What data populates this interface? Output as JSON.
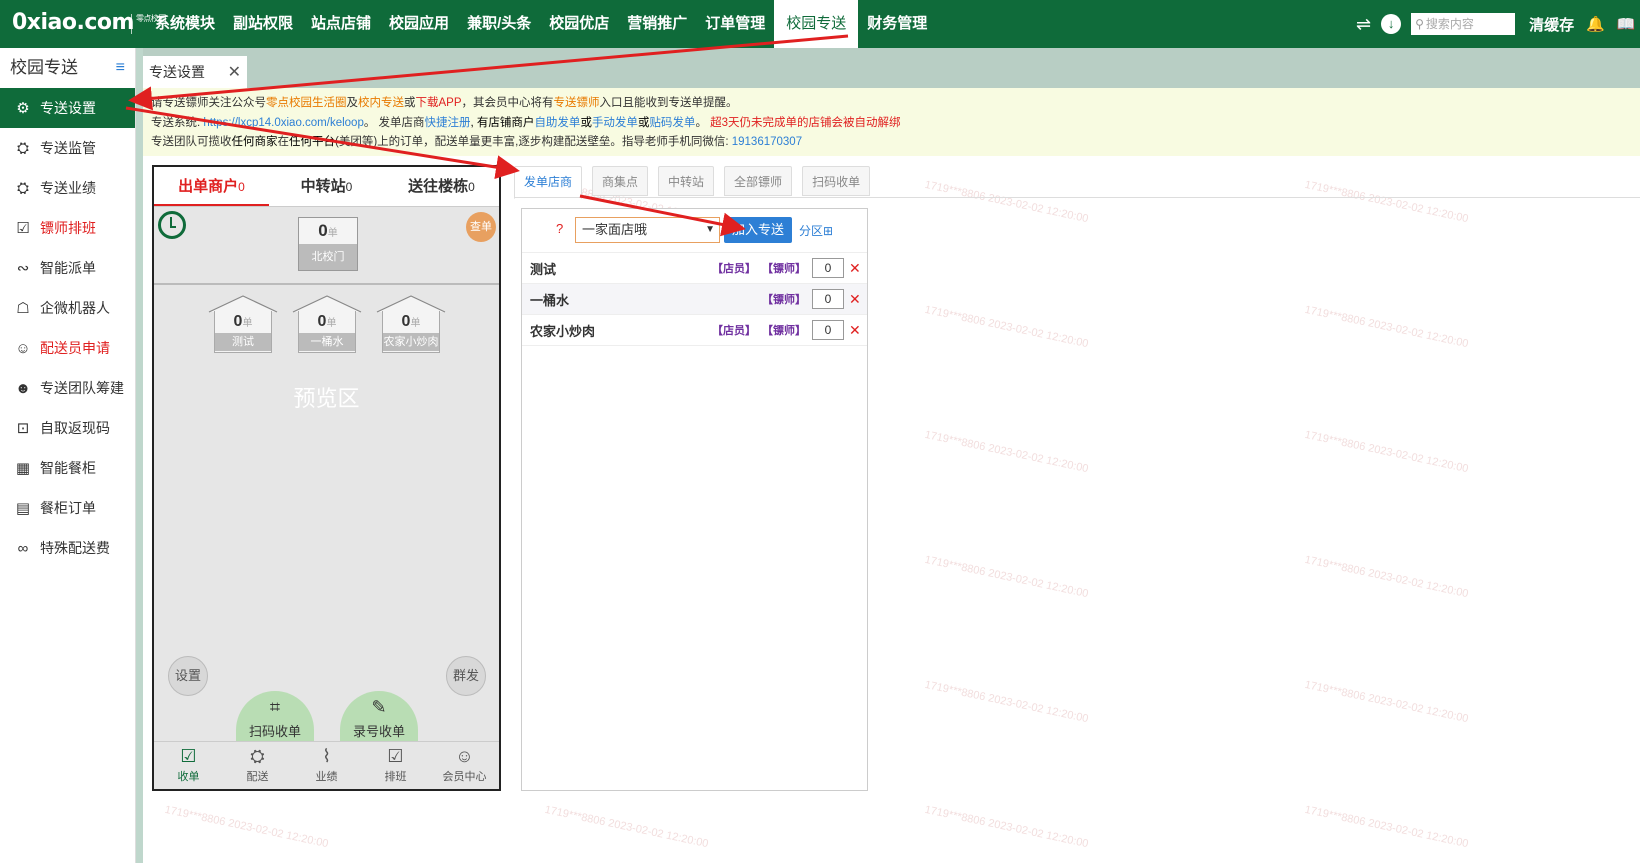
{
  "logo": {
    "text": "0xiao.com",
    "sub": "零点校园"
  },
  "nav": {
    "items": [
      "系统模块",
      "副站权限",
      "站点店铺",
      "校园应用",
      "兼职/头条",
      "校园优店",
      "营销推广",
      "订单管理",
      "校园专送",
      "财务管理"
    ],
    "active": "校园专送"
  },
  "top_right": {
    "switch_icon": "⇌",
    "download_icon": "↓",
    "search_placeholder": "搜索内容",
    "clear_cache": "清缓存",
    "bell_icon": "♫",
    "book_icon": "📖"
  },
  "sidebar": {
    "title": "校园专送",
    "toggle_icon": "≡",
    "items": [
      {
        "label": "专送设置",
        "icon": "⚙",
        "active": true,
        "red": false
      },
      {
        "label": "专送监管",
        "icon": "⛭",
        "active": false,
        "red": false
      },
      {
        "label": "专送业绩",
        "icon": "⛭",
        "active": false,
        "red": false
      },
      {
        "label": "镖师排班",
        "icon": "☑",
        "active": false,
        "red": true
      },
      {
        "label": "智能派单",
        "icon": "∾",
        "active": false,
        "red": false
      },
      {
        "label": "企微机器人",
        "icon": "☖",
        "active": false,
        "red": false
      },
      {
        "label": "配送员申请",
        "icon": "☺",
        "active": false,
        "red": true
      },
      {
        "label": "专送团队筹建",
        "icon": "☻",
        "active": false,
        "red": false
      },
      {
        "label": "自取返现码",
        "icon": "⊡",
        "active": false,
        "red": false
      },
      {
        "label": "智能餐柜",
        "icon": "▦",
        "active": false,
        "red": false
      },
      {
        "label": "餐柜订单",
        "icon": "▤",
        "active": false,
        "red": false
      },
      {
        "label": "特殊配送费",
        "icon": "∞",
        "active": false,
        "red": false
      }
    ]
  },
  "page_tab": {
    "label": "专送设置",
    "close": "✕"
  },
  "notice": {
    "l1_a": "请专送镖师关注公众号",
    "l1_b": "零点校园生活圈",
    "l1_c": "及",
    "l1_d": "校内专送",
    "l1_e": "或",
    "l1_f": "下载APP",
    "l1_g": "，其会员中心将有",
    "l1_h": "专送镖师",
    "l1_i": "入口且能收到专送单提醒。",
    "l2_a": "专送系统: ",
    "l2_b": "https://lxcp14.0xiao.com/keloop",
    "l2_c": "。 发单店商",
    "l2_d": "快捷注册",
    "l2_e": ", 有店铺商户",
    "l2_f": "自助发单",
    "l2_g": "或",
    "l2_h": "手动发单",
    "l2_i": "或",
    "l2_j": "贴码发单",
    "l2_k": "。 ",
    "l2_l": "超3天仍未完成单的店铺会被自动解绑",
    "l3_a": "专送团队可揽收",
    "l3_b": "任何商家",
    "l3_c": "在",
    "l3_d": "任何平台",
    "l3_e": "(美团等)上的订单，配送单量更丰富,逐步构建配送壁垒。指导老师手机同微信: ",
    "l3_f": "19136170307"
  },
  "phone": {
    "tabs": [
      {
        "label": "出单商户",
        "count": "0",
        "active": true
      },
      {
        "label": "中转站",
        "count": "0",
        "active": false
      },
      {
        "label": "送往楼栋",
        "count": "0",
        "active": false
      }
    ],
    "check_label": "查单",
    "gate": {
      "num": "0",
      "unit": "单",
      "label": "北校门"
    },
    "houses": [
      {
        "num": "0",
        "unit": "单",
        "label": "测试"
      },
      {
        "num": "0",
        "unit": "单",
        "label": "一桶水"
      },
      {
        "num": "0",
        "unit": "单",
        "label": "农家小炒肉"
      }
    ],
    "preview_label": "预览区",
    "settings_label": "设置",
    "broadcast_label": "群发",
    "scan_label": "扫码收单",
    "scan_icon": "⌗",
    "record_label": "录号收单",
    "record_icon": "✎",
    "footer": [
      {
        "label": "收单",
        "icon": "☑",
        "active": true
      },
      {
        "label": "配送",
        "icon": "⛭",
        "active": false
      },
      {
        "label": "业绩",
        "icon": "⌇",
        "active": false
      },
      {
        "label": "排班",
        "icon": "☑",
        "active": false
      },
      {
        "label": "会员中心",
        "icon": "☺",
        "active": false
      }
    ]
  },
  "sub_tabs": {
    "items": [
      "发单店商",
      "商集点",
      "中转站",
      "全部镖师",
      "扫码收单"
    ],
    "active": "发单店商"
  },
  "panel": {
    "q_icon": "?",
    "select_value": "一家面店哦",
    "select_arrow": "▼",
    "add_button": "加入专送",
    "zone_link": "分区⊞",
    "rows": [
      {
        "name": "测试",
        "shop_tag": "【店员】",
        "rider_tag": "【镖师】",
        "qty": "0"
      },
      {
        "name": "一桶水",
        "shop_tag": "",
        "rider_tag": "【镖师】",
        "qty": "0"
      },
      {
        "name": "农家小炒肉",
        "shop_tag": "【店员】",
        "rider_tag": "【镖师】",
        "qty": "0"
      }
    ],
    "delete_icon": "✕"
  },
  "watermark": {
    "text": "1719***8806 2023-02-02 12:20:00"
  },
  "colors": {
    "brand": "#0f6b3a",
    "accent": "#2d7fd5",
    "danger": "#e02020",
    "annotation": "#e02020"
  }
}
